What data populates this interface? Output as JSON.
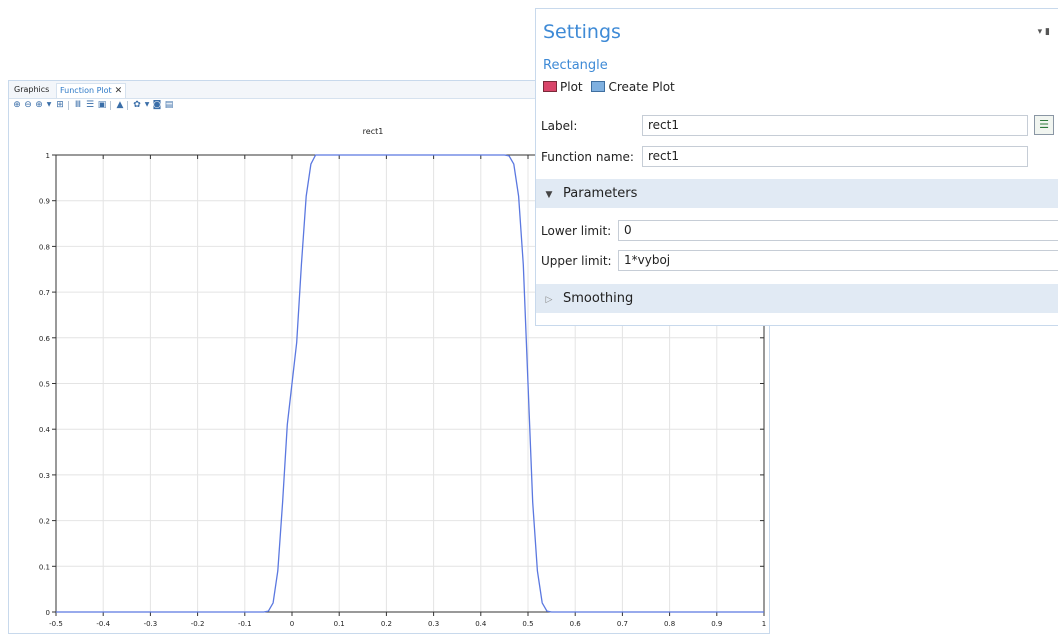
{
  "plot_window": {
    "tabs": [
      {
        "label": "Graphics",
        "active": false
      },
      {
        "label": "Function Plot",
        "active": true
      }
    ],
    "close_glyph": "✕",
    "toolbar_icons": [
      "zoom-in-icon",
      "zoom-out-icon",
      "zoom-box-icon",
      "zoom-extents-icon",
      "grid-icon",
      "table-icon",
      "legend-icon",
      "lock-icon",
      "color-icon",
      "camera-icon",
      "print-icon"
    ]
  },
  "chart_data": {
    "type": "line",
    "title": "rect1",
    "xlabel": "",
    "ylabel": "",
    "xlim": [
      -0.5,
      1
    ],
    "ylim": [
      0,
      1
    ],
    "xticks": [
      "-0.5",
      "-0.4",
      "-0.3",
      "-0.2",
      "-0.1",
      "0",
      "0.1",
      "0.2",
      "0.3",
      "0.4",
      "0.5",
      "0.6",
      "0.7",
      "0.8",
      "0.9",
      "1"
    ],
    "yticks": [
      "0",
      "0.1",
      "0.2",
      "0.3",
      "0.4",
      "0.5",
      "0.6",
      "0.7",
      "0.8",
      "0.9",
      "1"
    ],
    "grid": true,
    "series": [
      {
        "name": "",
        "color": "#5b78e0",
        "x": [
          -0.5,
          -0.06,
          -0.05,
          -0.04,
          -0.03,
          -0.02,
          -0.01,
          0,
          0.01,
          0.02,
          0.03,
          0.04,
          0.05,
          0.45,
          0.46,
          0.47,
          0.48,
          0.49,
          0.5,
          0.51,
          0.52,
          0.53,
          0.54,
          0.55,
          0.56,
          1
        ],
        "y": [
          0,
          0,
          0.002,
          0.02,
          0.09,
          0.24,
          0.41,
          0.5,
          0.59,
          0.76,
          0.91,
          0.98,
          1,
          1,
          0.998,
          0.98,
          0.91,
          0.76,
          0.5,
          0.24,
          0.09,
          0.02,
          0.002,
          0,
          0,
          0
        ]
      }
    ]
  },
  "settings": {
    "title": "Settings",
    "subtitle": "Rectangle",
    "pin_glyph": "▾ ▮",
    "actions": [
      {
        "label": "Plot",
        "icon": "plot-icon"
      },
      {
        "label": "Create Plot",
        "icon": "create-plot-icon"
      }
    ],
    "label_field": {
      "label": "Label:",
      "value": "rect1"
    },
    "function_name_field": {
      "label": "Function name:",
      "value": "rect1"
    },
    "parameters_section": {
      "title": "Parameters",
      "expanded": true
    },
    "lower_limit": {
      "label": "Lower limit:",
      "value": "0"
    },
    "upper_limit": {
      "label": "Upper limit:",
      "value": "1*vyboj"
    },
    "smoothing_section": {
      "title": "Smoothing",
      "expanded": false
    }
  }
}
